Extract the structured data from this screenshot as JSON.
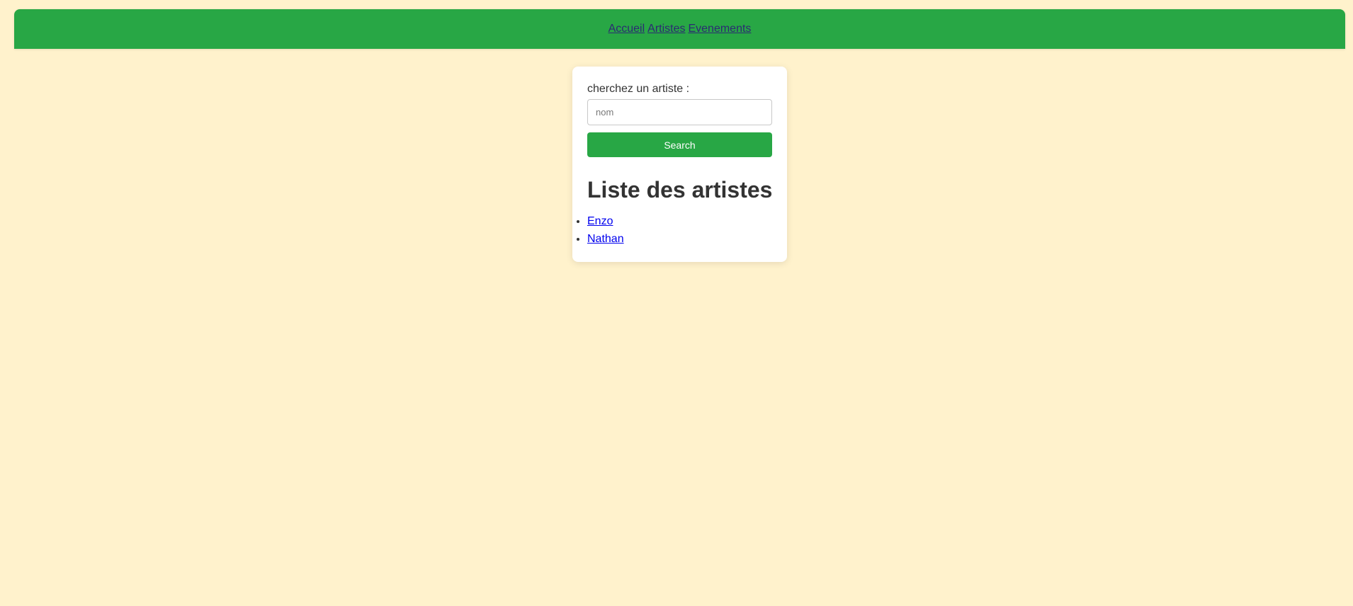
{
  "nav": {
    "links": [
      {
        "label": "Accueil"
      },
      {
        "label": "Artistes"
      },
      {
        "label": "Evenements"
      }
    ]
  },
  "search": {
    "label": "cherchez un artiste :",
    "placeholder": "nom",
    "value": "",
    "button_label": "Search"
  },
  "artists": {
    "title": "Liste des artistes",
    "items": [
      {
        "name": "Enzo"
      },
      {
        "name": "Nathan"
      }
    ]
  },
  "colors": {
    "background": "#fff2cc",
    "accent": "#28a745",
    "card": "#ffffff",
    "link": "#0000ee",
    "nav_link": "#2b2b72"
  }
}
